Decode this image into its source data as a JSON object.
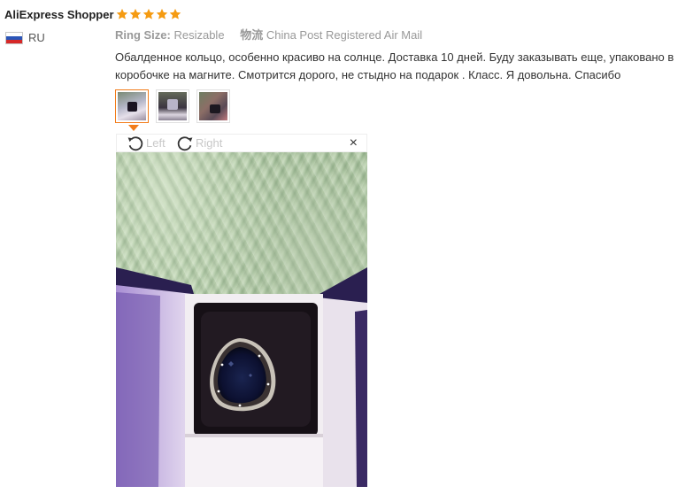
{
  "review": {
    "username": "AliExpress Shopper",
    "country_code": "RU",
    "rating": 5,
    "ring_size_label": "Ring Size:",
    "ring_size_value": "Resizable",
    "shipping_label": "物流",
    "shipping_value": "China Post Registered Air Mail",
    "text": "Обалденное кольцо, особенно красиво на солнце. Доставка 10 дней. Буду заказывать еще, упаковано в коробочке на магните. Смотрится дорого, не стыдно на подарок . Класс. Я довольна. Спасибо"
  },
  "viewer": {
    "rotate_left_label": "Left",
    "rotate_right_label": "Right",
    "close_label": "×"
  },
  "colors": {
    "star": "#f59b12",
    "accent": "#f27c1a"
  },
  "icons": {
    "rotate_left": "rotate-ccw-icon",
    "rotate_right": "rotate-cw-icon",
    "close": "close-icon",
    "flag": "russia-flag-icon",
    "star": "star-icon"
  }
}
